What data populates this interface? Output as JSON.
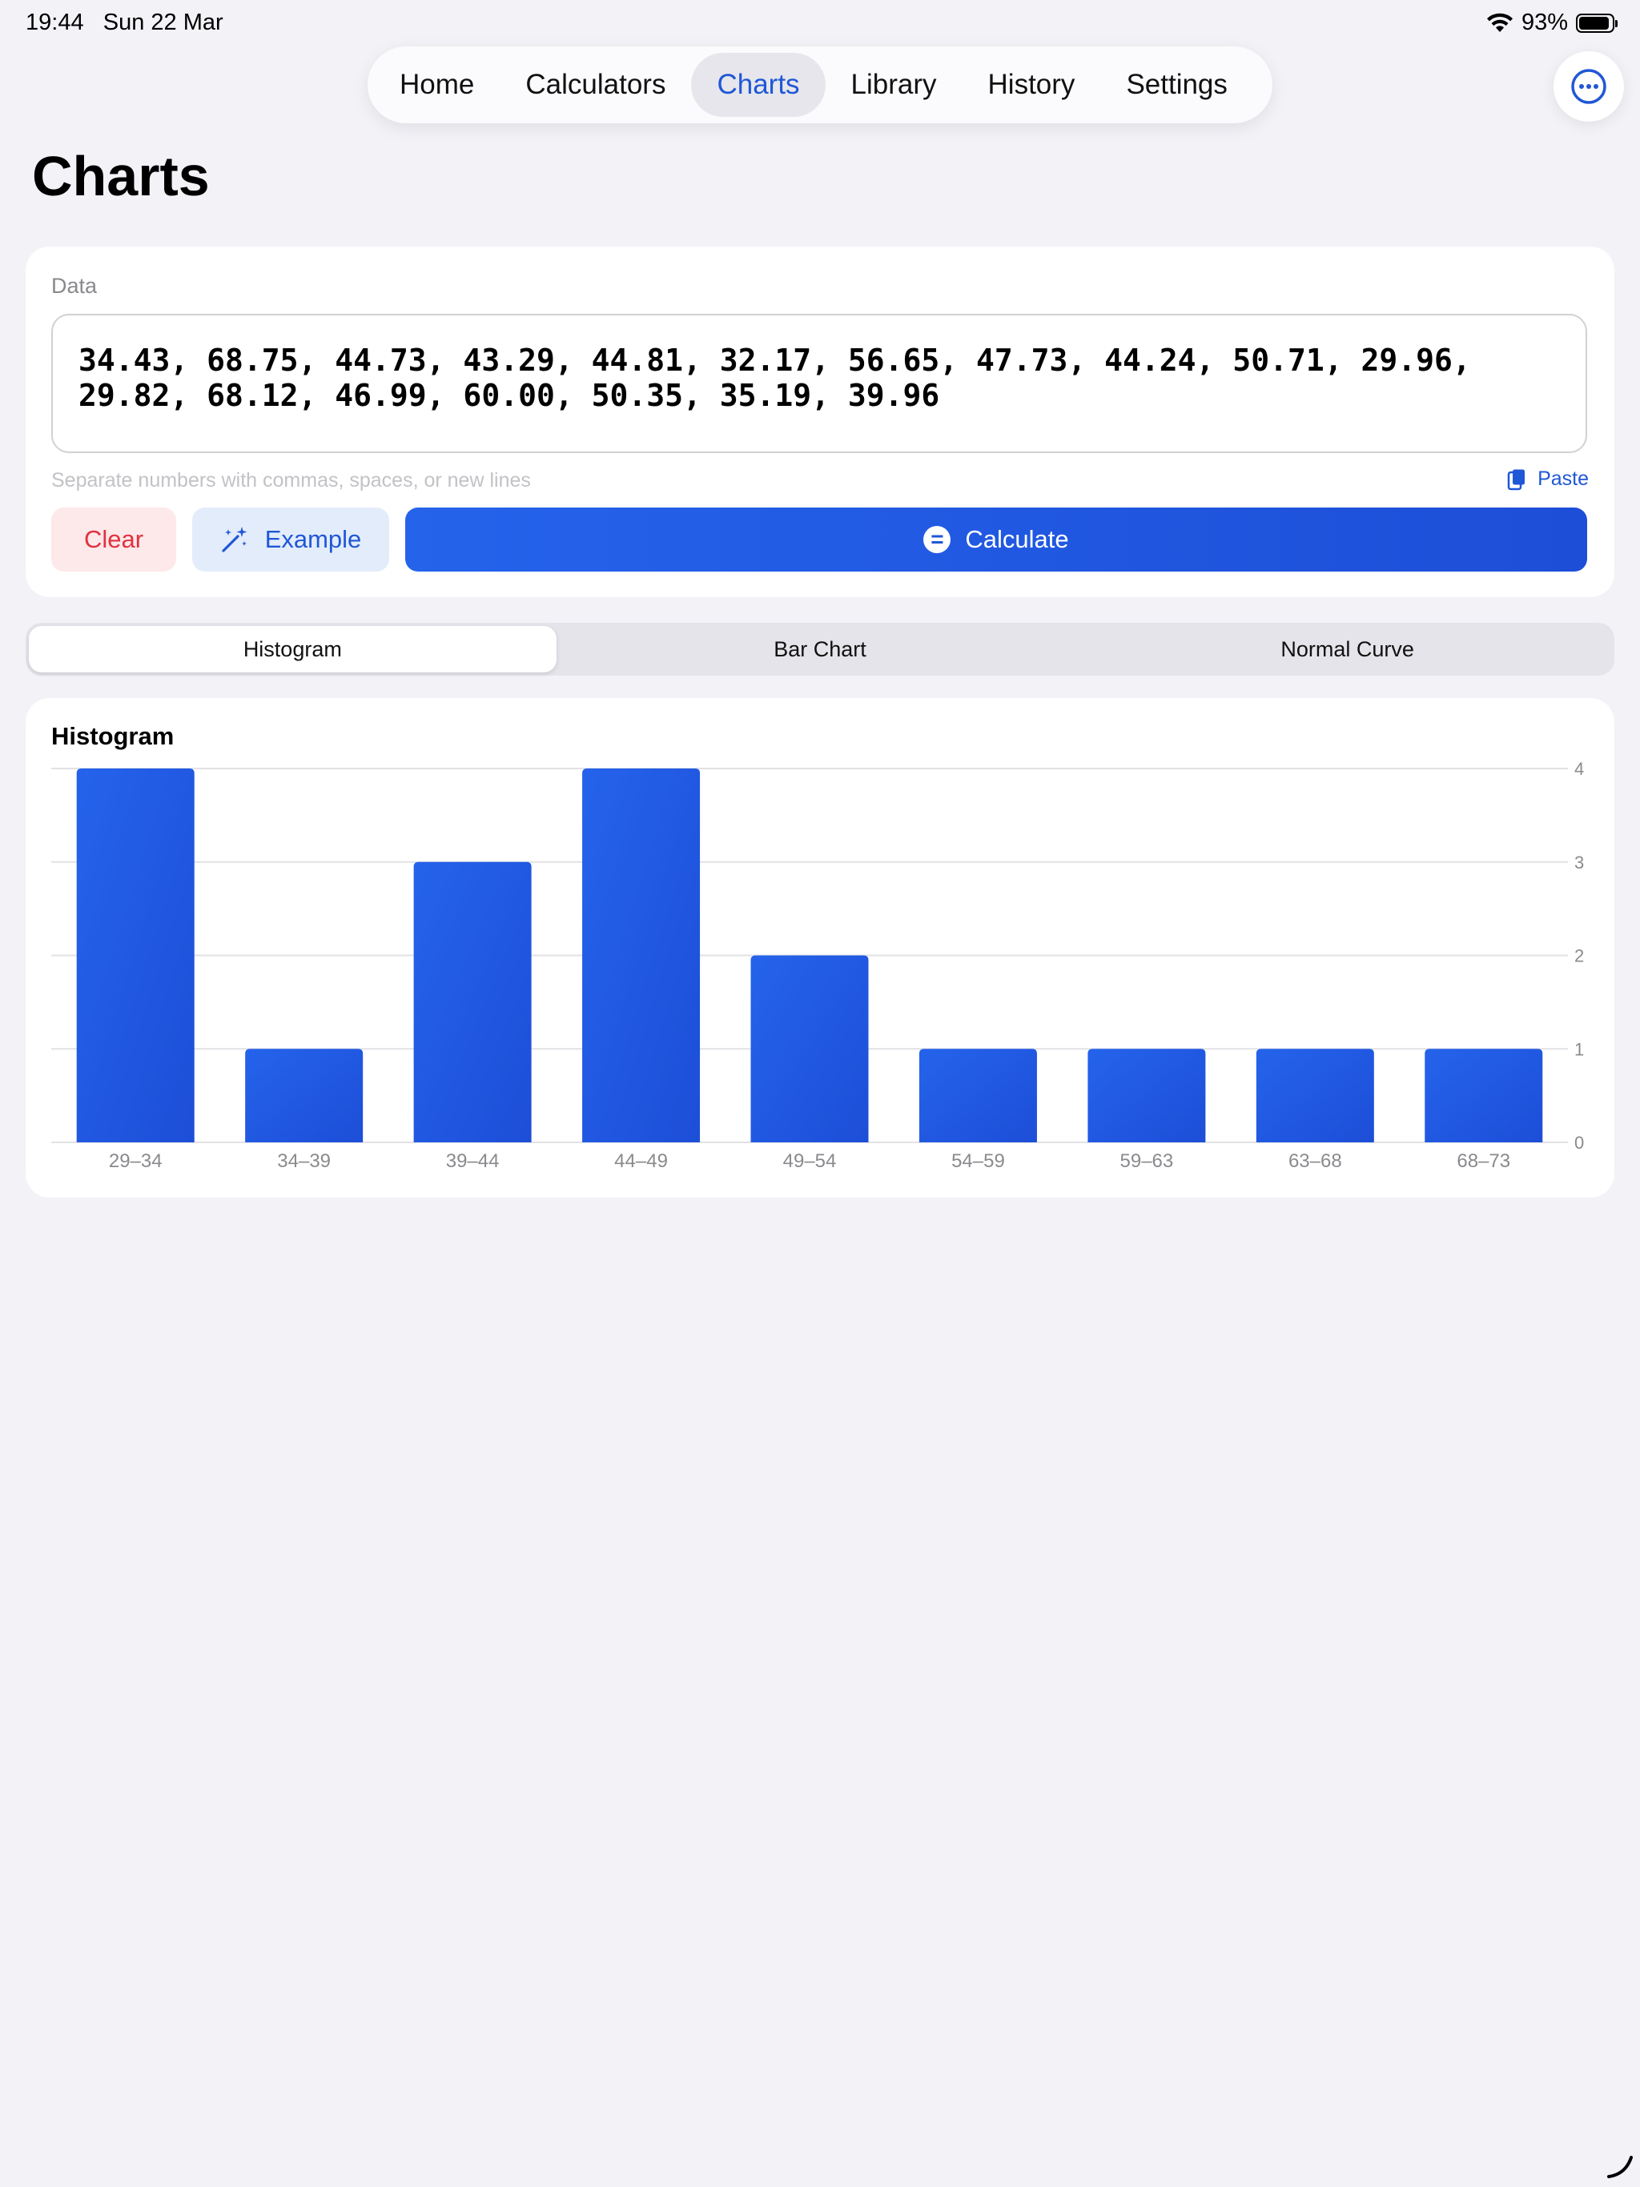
{
  "status": {
    "time": "19:44",
    "date": "Sun 22 Mar",
    "battery_percent": "93%",
    "battery_level": 0.93
  },
  "nav": {
    "tabs": [
      {
        "label": "Home",
        "active": false
      },
      {
        "label": "Calculators",
        "active": false
      },
      {
        "label": "Charts",
        "active": true
      },
      {
        "label": "Library",
        "active": false
      },
      {
        "label": "History",
        "active": false
      },
      {
        "label": "Settings",
        "active": false
      }
    ]
  },
  "page": {
    "title": "Charts"
  },
  "data_card": {
    "label": "Data",
    "value": "34.43, 68.75, 44.73, 43.29, 44.81, 32.17, 56.65, 47.73, 44.24, 50.71, 29.96, 29.82, 68.12, 46.99, 60.00, 50.35, 35.19, 39.96",
    "hint": "Separate numbers with commas, spaces, or new lines",
    "paste_label": "Paste",
    "clear_label": "Clear",
    "example_label": "Example",
    "calculate_label": "Calculate"
  },
  "segments": [
    {
      "label": "Histogram",
      "active": true
    },
    {
      "label": "Bar Chart",
      "active": false
    },
    {
      "label": "Normal Curve",
      "active": false
    }
  ],
  "colors": {
    "accent": "#1f57d6",
    "bar_top": "#2563eb",
    "bar_bottom": "#1d4ed8",
    "clear": "#e0323f",
    "background": "#f2f2f7"
  },
  "chart_data": {
    "type": "bar",
    "title": "Histogram",
    "categories": [
      "29–34",
      "34–39",
      "39–44",
      "44–49",
      "49–54",
      "54–59",
      "59–63",
      "63–68",
      "68–73"
    ],
    "values": [
      4,
      1,
      3,
      4,
      2,
      1,
      1,
      1,
      1
    ],
    "yticks": [
      0,
      1,
      2,
      3,
      4
    ],
    "ylim": [
      0,
      4
    ],
    "grid": true,
    "y_axis_side": "right"
  }
}
